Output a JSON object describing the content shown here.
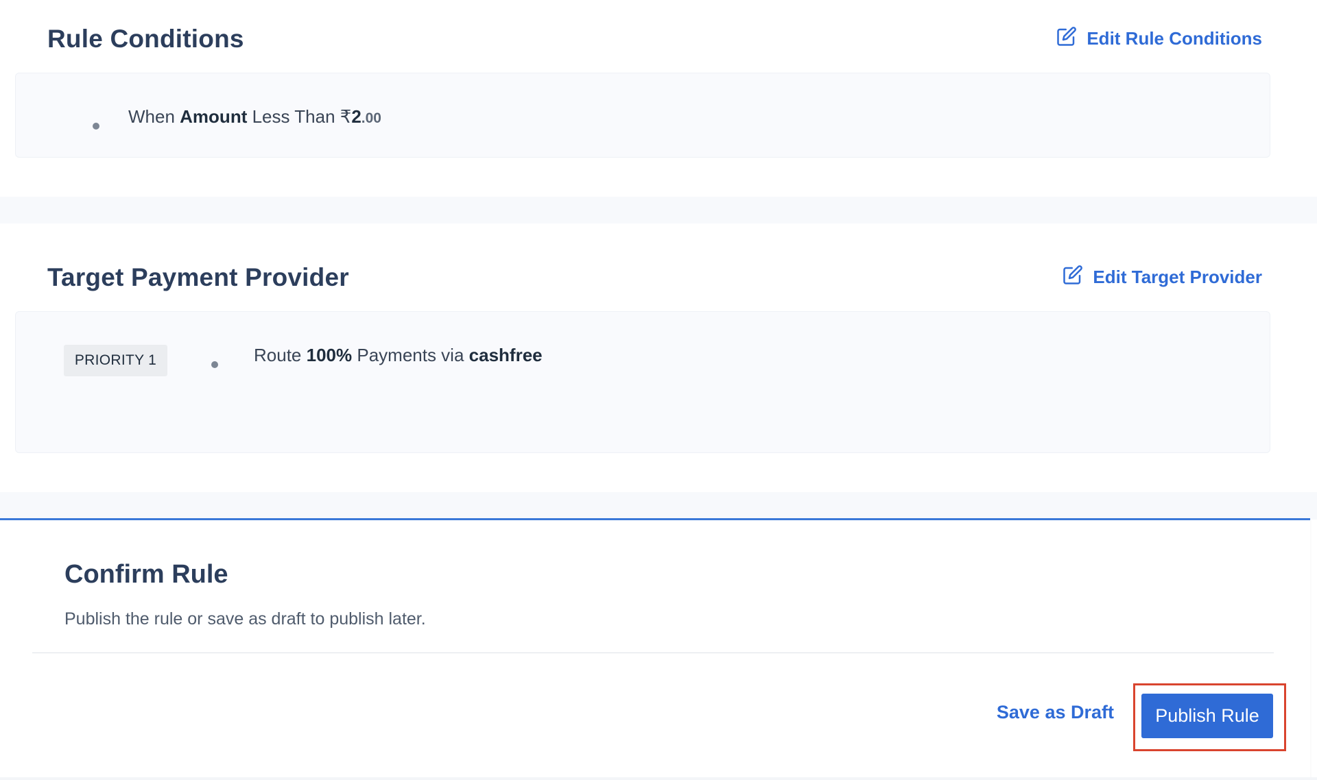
{
  "rule_conditions": {
    "title": "Rule Conditions",
    "edit_label": "Edit Rule Conditions",
    "condition": {
      "prefix": "When",
      "field": "Amount",
      "operator": "Less Than",
      "currency": "₹",
      "amount_whole": "2",
      "amount_cents": ".00"
    }
  },
  "target_provider": {
    "title": "Target Payment Provider",
    "edit_label": "Edit Target Provider",
    "priority_label": "PRIORITY 1",
    "route": {
      "prefix": "Route",
      "percent": "100%",
      "middle": "Payments via",
      "provider": "cashfree"
    }
  },
  "confirm": {
    "title": "Confirm Rule",
    "description": "Publish the rule or save as draft to publish later.",
    "save_draft_label": "Save as Draft",
    "publish_label": "Publish Rule"
  },
  "colors": {
    "accent": "#2f6bd6",
    "highlight_border": "#d9442e",
    "heading": "#2c3e5c"
  }
}
